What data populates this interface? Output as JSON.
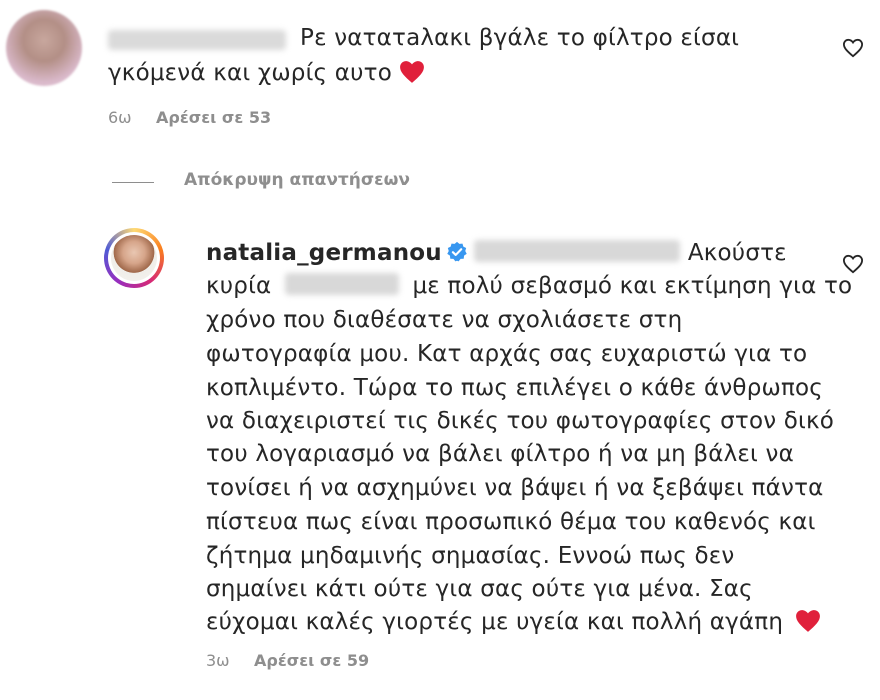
{
  "comment1": {
    "text_line1": "Ρε νατατaλακι βγάλε το φίλτρο είσαι",
    "text_line2": "γκόμενά και χωρίς αυτο",
    "time": "6ω",
    "likes": "Αρέσει σε 53"
  },
  "replies_toggle": "Απόκρυψη απαντήσεων",
  "reply": {
    "username": "natalia_germanou",
    "first_word": "Ακούστε",
    "line2_a": "κυρία",
    "line2_b": "με πολύ σεβασμό και εκτίμηση για το",
    "lines": [
      "χρόνο που διαθέσατε να σχολιάσετε στη",
      "φωτογραφία μου. Κατ αρχάς σας ευχαριστώ για το",
      "κοπλιμέντο. Τώρα το πως επιλέγει ο κάθε άνθρωπος",
      "να διαχειριστεί τις δικές του φωτογραφίες στον δικό",
      "του λογαριασμό να βάλει φίλτρο ή να μη βάλει να",
      "τονίσει ή να ασχημύνει να βάψει ή να ξεβάψει πάντα",
      "πίστευα πως είναι προσωπικό θέμα του καθενός και",
      "ζήτημα μηδαμινής σημασίας. Εννοώ πως δεν",
      "σημαίνει κάτι ούτε για σας ούτε για μένα. Σας",
      "εύχομαι καλές γιορτές με υγεία και πολλή αγάπη"
    ],
    "time": "3ω",
    "likes": "Αρέσει σε 59"
  },
  "colors": {
    "heart": "#e0203b",
    "verified": "#3897f0",
    "meta": "#8e8e8e"
  },
  "icons": [
    "avatar",
    "heart-outline-icon",
    "heart-emoji-icon",
    "verified-badge-icon"
  ]
}
